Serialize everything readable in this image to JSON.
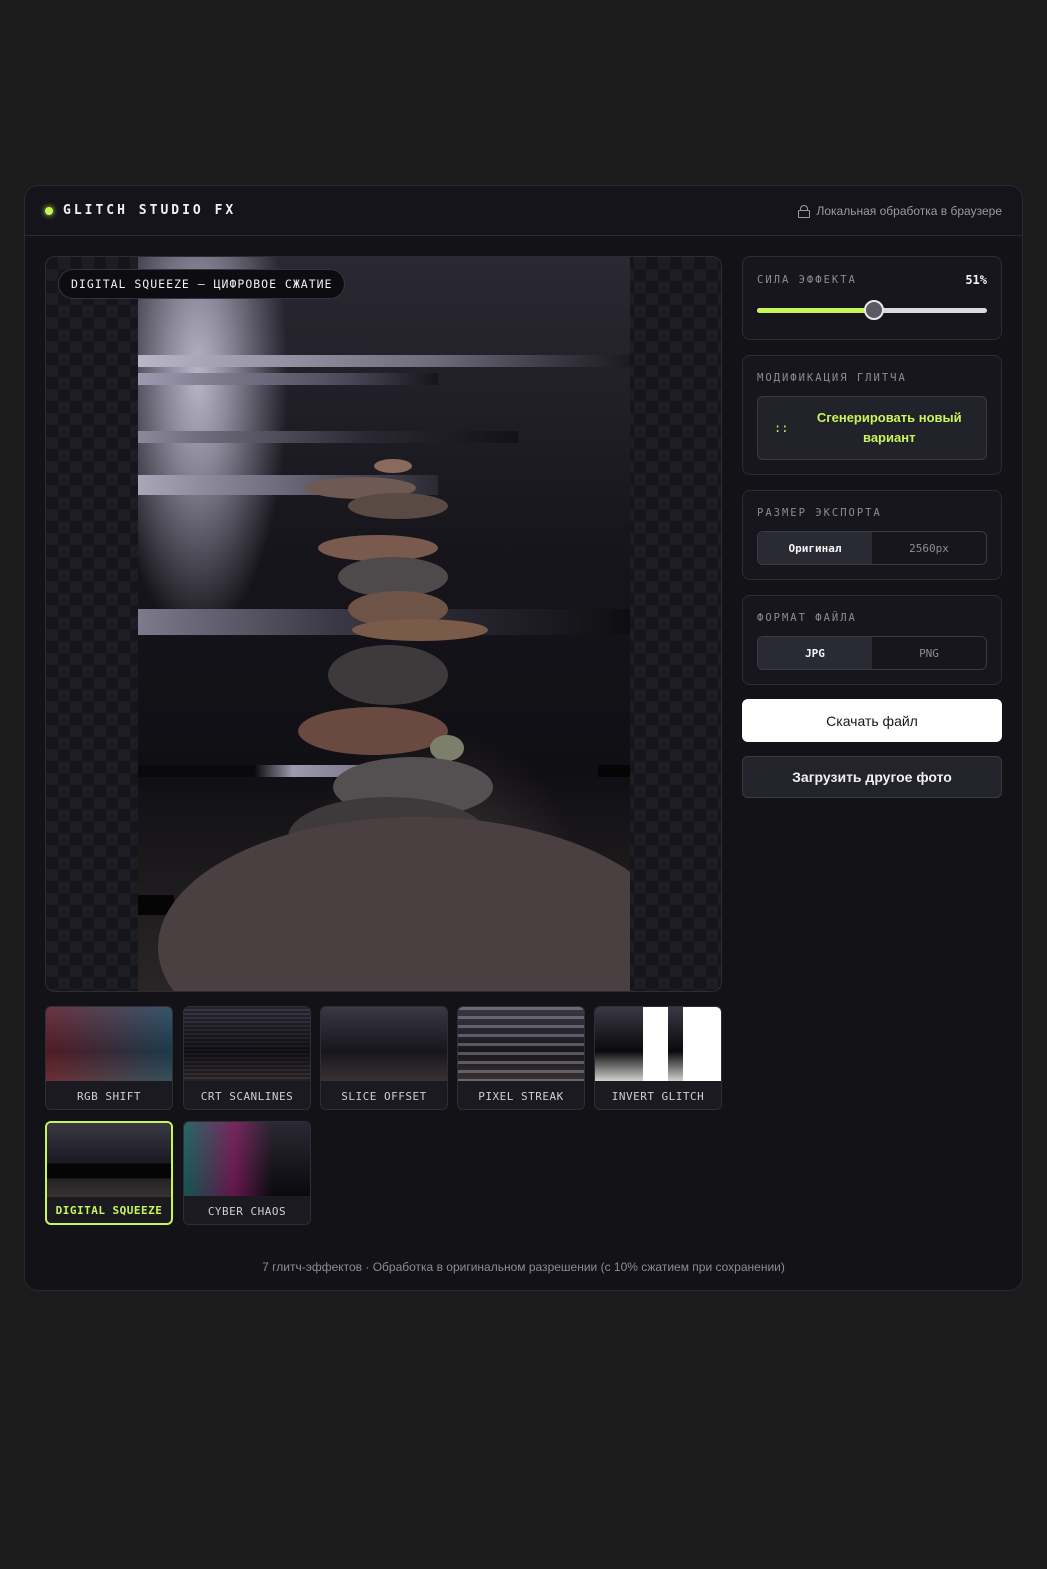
{
  "header": {
    "brand": "GLITCH STUDIO FX",
    "local_note": "Локальная обработка в браузере"
  },
  "preview": {
    "badge": "DIGITAL SQUEEZE — ЦИФРОВОЕ СЖАТИЕ"
  },
  "effects": [
    {
      "label": "RGB SHIFT",
      "active": false
    },
    {
      "label": "CRT SCANLINES",
      "active": false
    },
    {
      "label": "SLICE OFFSET",
      "active": false
    },
    {
      "label": "PIXEL STREAK",
      "active": false
    },
    {
      "label": "INVERT GLITCH",
      "active": false
    },
    {
      "label": "DIGITAL SQUEEZE",
      "active": true
    },
    {
      "label": "CYBER CHAOS",
      "active": false
    }
  ],
  "strength": {
    "label": "СИЛА ЭФФЕКТА",
    "value_text": "51%",
    "value": 0.51
  },
  "modify": {
    "label": "МОДИФИКАЦИЯ ГЛИТЧА",
    "icon": "::",
    "button": "Сгенерировать новый вариант"
  },
  "export_size": {
    "label": "РАЗМЕР ЭКСПОРТА",
    "options": [
      "Оригинал",
      "2560px"
    ],
    "selected": "Оригинал"
  },
  "file_format": {
    "label": "ФОРМАТ ФАЙЛА",
    "options": [
      "JPG",
      "PNG"
    ],
    "selected": "JPG"
  },
  "actions": {
    "download": "Скачать файл",
    "upload": "Загрузить другое фото"
  },
  "footer": "7 глитч-эффектов · Обработка в оригинальном разрешении (с 10% сжатием при сохранении)",
  "colors": {
    "accent": "#c8f55a",
    "background": "#1b1b1c",
    "panel": "#16161c"
  }
}
